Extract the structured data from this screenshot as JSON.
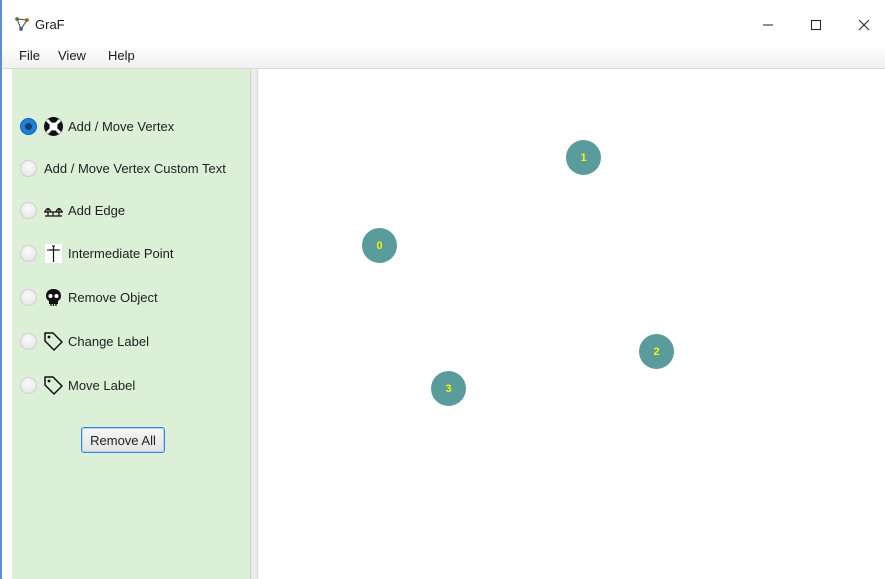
{
  "window": {
    "title": "GraF",
    "controls": {
      "minimize": "—",
      "maximize": "☐",
      "close": "✕"
    }
  },
  "menu": [
    "File",
    "View",
    "Help"
  ],
  "sidebar": {
    "options": [
      {
        "label": "Add / Move Vertex",
        "icon": "lifebuoy-icon",
        "selected": true
      },
      {
        "label": "Add / Move Vertex Custom Text",
        "icon": "",
        "selected": false
      },
      {
        "label": "Add Edge",
        "icon": "bridge-icon",
        "selected": false
      },
      {
        "label": "Intermediate Point",
        "icon": "cross-icon",
        "selected": false
      },
      {
        "label": "Remove Object",
        "icon": "skull-icon",
        "selected": false
      },
      {
        "label": "Change Label",
        "icon": "tag-icon",
        "selected": false
      },
      {
        "label": "Move Label",
        "icon": "tag-icon",
        "selected": false
      }
    ],
    "remove_all_label": "Remove All"
  },
  "canvas": {
    "vertices": [
      {
        "label": "0"
      },
      {
        "label": "1"
      },
      {
        "label": "2"
      },
      {
        "label": "3"
      }
    ]
  },
  "colors": {
    "sidebar_bg": "#dcefd7",
    "vertex_fill": "#5a9b9b",
    "vertex_text": "#f4f400",
    "selected_radio": "#1e7fd9"
  }
}
